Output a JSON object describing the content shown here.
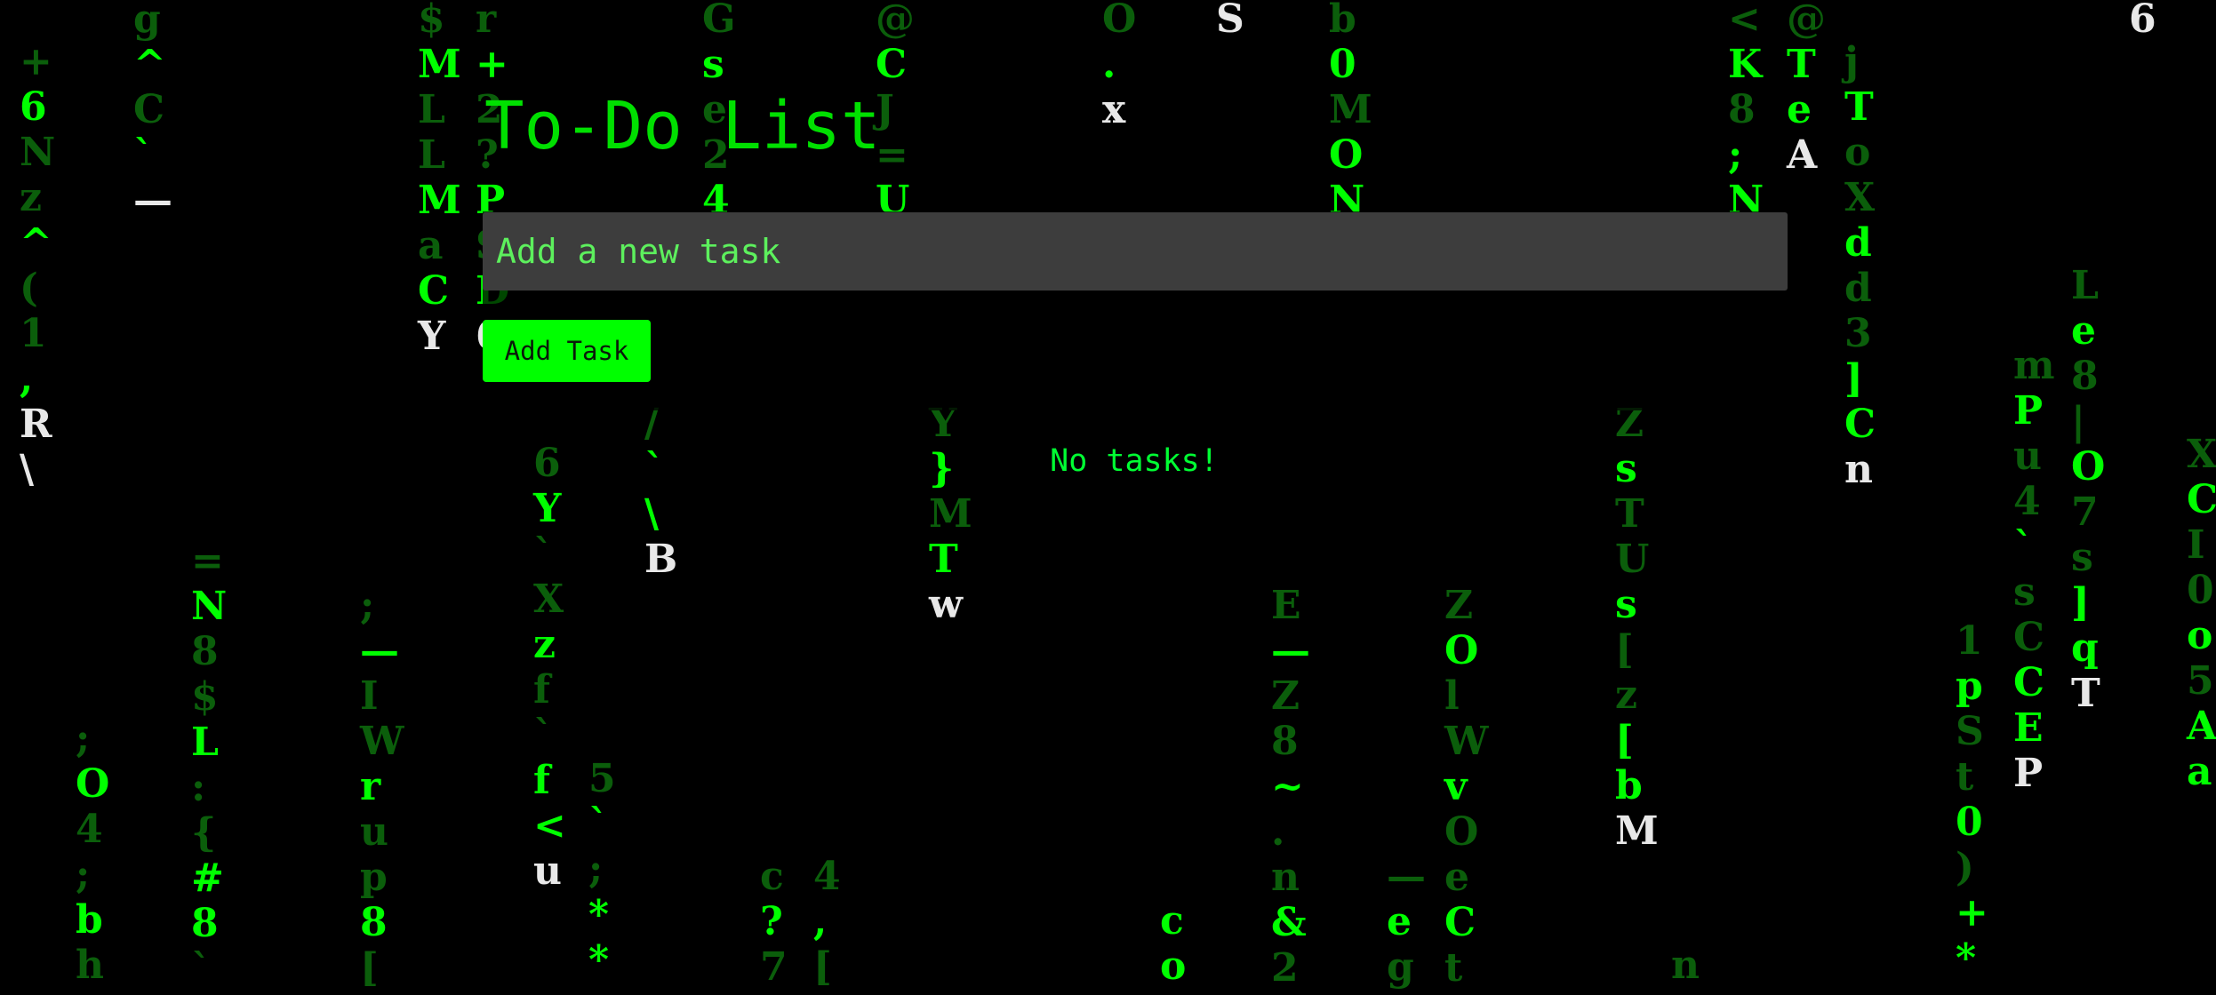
{
  "app": {
    "title": "To-Do List"
  },
  "form": {
    "input_placeholder": "Add a new task",
    "input_value": "",
    "add_button_label": "Add Task"
  },
  "tasks": {
    "items": [],
    "empty_message": "No tasks!"
  },
  "background": {
    "effect": "matrix-digital-rain",
    "base_color": "#000000",
    "glyph_color_bright": "#00ff00",
    "glyph_color_dim": "#0b5e0b",
    "glyph_color_head": "#e8e8e8",
    "columns": [
      {
        "glyphs": [
          "+",
          "6",
          "N",
          "z",
          "^",
          "(",
          "1",
          ",",
          "R",
          "\\"
        ],
        "heads": [
          "R",
          "\\"
        ]
      },
      {
        "glyphs": [
          "g",
          "^",
          "C",
          "`",
          "—"
        ],
        "heads": [
          "—"
        ]
      },
      {
        "glyphs": [
          "$",
          "M",
          "L",
          "L",
          "M",
          "a",
          "C",
          "Y"
        ],
        "heads": [
          "Y"
        ]
      },
      {
        "glyphs": [
          "r",
          "+",
          "2",
          "?",
          "P",
          "S",
          "D",
          "6"
        ],
        "heads": [
          "6"
        ]
      },
      {
        "glyphs": [
          "G",
          "s",
          "e",
          "2",
          "4",
          "<"
        ],
        "heads": []
      },
      {
        "glyphs": [
          "@",
          "C",
          "J",
          "=",
          "U",
          "$"
        ],
        "heads": []
      },
      {
        "glyphs": [
          "O",
          ".",
          "x"
        ],
        "heads": [
          "x"
        ]
      },
      {
        "glyphs": [
          "S"
        ],
        "heads": [
          "S"
        ]
      },
      {
        "glyphs": [
          "b",
          "0",
          "M",
          "O",
          "N"
        ],
        "heads": []
      },
      {
        "glyphs": [
          "<",
          "K",
          "8",
          ";",
          "N"
        ],
        "heads": []
      },
      {
        "glyphs": [
          "@",
          "T",
          "e",
          "A"
        ],
        "heads": [
          "A"
        ]
      },
      {
        "glyphs": [
          "j",
          "T",
          "o",
          "X",
          "d",
          "d",
          "3",
          "]",
          "C",
          "n"
        ],
        "heads": [
          "n"
        ]
      },
      {
        "glyphs": [
          "6"
        ],
        "heads": [
          "6"
        ]
      },
      {
        "glyphs": [
          "L",
          "e",
          "8",
          "|",
          "O",
          "7",
          "s",
          "]",
          "q",
          "T"
        ],
        "heads": [
          "T"
        ]
      },
      {
        "glyphs": [
          "m",
          "P",
          "u",
          "4",
          "`",
          "s",
          "C",
          "C",
          "E",
          "P"
        ],
        "heads": [
          "P"
        ]
      },
      {
        "glyphs": [
          "X",
          "C",
          "I",
          "0",
          "o",
          "5",
          "A",
          "a"
        ],
        "heads": []
      },
      {
        "glyphs": [
          "6",
          "Y",
          "`",
          "X",
          "z",
          "f",
          "`",
          "f",
          "<",
          "u"
        ],
        "heads": [
          "u"
        ]
      },
      {
        "glyphs": [
          "/",
          "`",
          "\\",
          "B"
        ],
        "heads": [
          "B"
        ]
      },
      {
        "glyphs": [
          "Y",
          "}",
          "M",
          "T",
          "w"
        ],
        "heads": [
          "w"
        ]
      },
      {
        "glyphs": [
          "=",
          "N",
          "8",
          "$",
          "L",
          ":",
          "{",
          "#",
          "8",
          "`"
        ],
        "heads": []
      },
      {
        "glyphs": [
          ";",
          "—",
          "I",
          "W",
          "r",
          "u",
          "p",
          "8",
          "["
        ],
        "heads": []
      },
      {
        "glyphs": [
          "E",
          "—",
          "Z",
          "8",
          "~",
          ".",
          "n",
          "&",
          "2"
        ],
        "heads": []
      },
      {
        "glyphs": [
          "Z",
          "O",
          "l",
          "W",
          "v",
          "O",
          "e",
          "C",
          "t"
        ],
        "heads": []
      },
      {
        "glyphs": [
          "Z",
          "s",
          "T",
          "U",
          "s",
          "[",
          "z",
          "[",
          "b",
          "M"
        ],
        "heads": [
          "M"
        ]
      },
      {
        "glyphs": [
          "1",
          "p",
          "S",
          "t",
          "0",
          ")",
          "+",
          "*"
        ],
        "heads": []
      },
      {
        "glyphs": [
          ";",
          "O",
          "4",
          ";",
          "b",
          "h"
        ],
        "heads": []
      },
      {
        "glyphs": [
          "5",
          "`",
          ";",
          "*",
          "*"
        ],
        "heads": []
      },
      {
        "glyphs": [
          "c",
          "?",
          "7"
        ],
        "heads": []
      },
      {
        "glyphs": [
          "4",
          ",",
          "["
        ],
        "heads": []
      },
      {
        "glyphs": [
          "c",
          "o"
        ],
        "heads": []
      },
      {
        "glyphs": [
          "—",
          "e",
          "g"
        ],
        "heads": []
      },
      {
        "glyphs": [
          "n"
        ],
        "heads": []
      }
    ]
  }
}
